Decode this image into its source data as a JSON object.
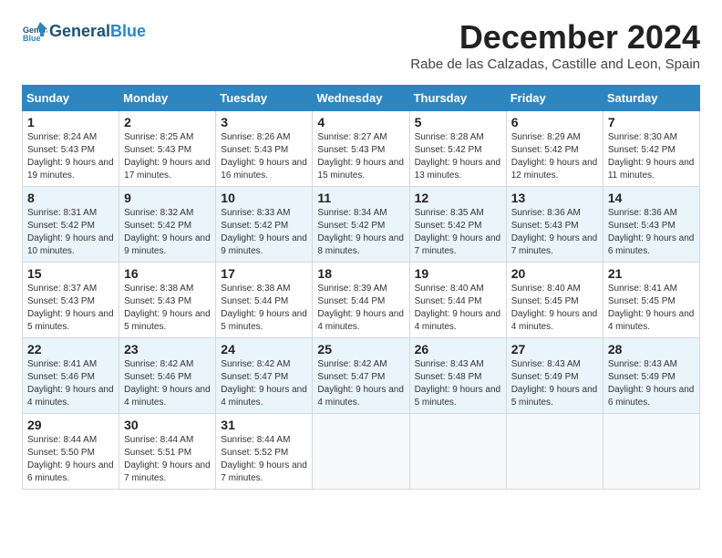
{
  "header": {
    "logo_general": "General",
    "logo_blue": "Blue",
    "month_title": "December 2024",
    "location": "Rabe de las Calzadas, Castille and Leon, Spain"
  },
  "weekdays": [
    "Sunday",
    "Monday",
    "Tuesday",
    "Wednesday",
    "Thursday",
    "Friday",
    "Saturday"
  ],
  "weeks": [
    [
      {
        "day": "1",
        "sunrise": "Sunrise: 8:24 AM",
        "sunset": "Sunset: 5:43 PM",
        "daylight": "Daylight: 9 hours and 19 minutes."
      },
      {
        "day": "2",
        "sunrise": "Sunrise: 8:25 AM",
        "sunset": "Sunset: 5:43 PM",
        "daylight": "Daylight: 9 hours and 17 minutes."
      },
      {
        "day": "3",
        "sunrise": "Sunrise: 8:26 AM",
        "sunset": "Sunset: 5:43 PM",
        "daylight": "Daylight: 9 hours and 16 minutes."
      },
      {
        "day": "4",
        "sunrise": "Sunrise: 8:27 AM",
        "sunset": "Sunset: 5:43 PM",
        "daylight": "Daylight: 9 hours and 15 minutes."
      },
      {
        "day": "5",
        "sunrise": "Sunrise: 8:28 AM",
        "sunset": "Sunset: 5:42 PM",
        "daylight": "Daylight: 9 hours and 13 minutes."
      },
      {
        "day": "6",
        "sunrise": "Sunrise: 8:29 AM",
        "sunset": "Sunset: 5:42 PM",
        "daylight": "Daylight: 9 hours and 12 minutes."
      },
      {
        "day": "7",
        "sunrise": "Sunrise: 8:30 AM",
        "sunset": "Sunset: 5:42 PM",
        "daylight": "Daylight: 9 hours and 11 minutes."
      }
    ],
    [
      {
        "day": "8",
        "sunrise": "Sunrise: 8:31 AM",
        "sunset": "Sunset: 5:42 PM",
        "daylight": "Daylight: 9 hours and 10 minutes."
      },
      {
        "day": "9",
        "sunrise": "Sunrise: 8:32 AM",
        "sunset": "Sunset: 5:42 PM",
        "daylight": "Daylight: 9 hours and 9 minutes."
      },
      {
        "day": "10",
        "sunrise": "Sunrise: 8:33 AM",
        "sunset": "Sunset: 5:42 PM",
        "daylight": "Daylight: 9 hours and 9 minutes."
      },
      {
        "day": "11",
        "sunrise": "Sunrise: 8:34 AM",
        "sunset": "Sunset: 5:42 PM",
        "daylight": "Daylight: 9 hours and 8 minutes."
      },
      {
        "day": "12",
        "sunrise": "Sunrise: 8:35 AM",
        "sunset": "Sunset: 5:42 PM",
        "daylight": "Daylight: 9 hours and 7 minutes."
      },
      {
        "day": "13",
        "sunrise": "Sunrise: 8:36 AM",
        "sunset": "Sunset: 5:43 PM",
        "daylight": "Daylight: 9 hours and 7 minutes."
      },
      {
        "day": "14",
        "sunrise": "Sunrise: 8:36 AM",
        "sunset": "Sunset: 5:43 PM",
        "daylight": "Daylight: 9 hours and 6 minutes."
      }
    ],
    [
      {
        "day": "15",
        "sunrise": "Sunrise: 8:37 AM",
        "sunset": "Sunset: 5:43 PM",
        "daylight": "Daylight: 9 hours and 5 minutes."
      },
      {
        "day": "16",
        "sunrise": "Sunrise: 8:38 AM",
        "sunset": "Sunset: 5:43 PM",
        "daylight": "Daylight: 9 hours and 5 minutes."
      },
      {
        "day": "17",
        "sunrise": "Sunrise: 8:38 AM",
        "sunset": "Sunset: 5:44 PM",
        "daylight": "Daylight: 9 hours and 5 minutes."
      },
      {
        "day": "18",
        "sunrise": "Sunrise: 8:39 AM",
        "sunset": "Sunset: 5:44 PM",
        "daylight": "Daylight: 9 hours and 4 minutes."
      },
      {
        "day": "19",
        "sunrise": "Sunrise: 8:40 AM",
        "sunset": "Sunset: 5:44 PM",
        "daylight": "Daylight: 9 hours and 4 minutes."
      },
      {
        "day": "20",
        "sunrise": "Sunrise: 8:40 AM",
        "sunset": "Sunset: 5:45 PM",
        "daylight": "Daylight: 9 hours and 4 minutes."
      },
      {
        "day": "21",
        "sunrise": "Sunrise: 8:41 AM",
        "sunset": "Sunset: 5:45 PM",
        "daylight": "Daylight: 9 hours and 4 minutes."
      }
    ],
    [
      {
        "day": "22",
        "sunrise": "Sunrise: 8:41 AM",
        "sunset": "Sunset: 5:46 PM",
        "daylight": "Daylight: 9 hours and 4 minutes."
      },
      {
        "day": "23",
        "sunrise": "Sunrise: 8:42 AM",
        "sunset": "Sunset: 5:46 PM",
        "daylight": "Daylight: 9 hours and 4 minutes."
      },
      {
        "day": "24",
        "sunrise": "Sunrise: 8:42 AM",
        "sunset": "Sunset: 5:47 PM",
        "daylight": "Daylight: 9 hours and 4 minutes."
      },
      {
        "day": "25",
        "sunrise": "Sunrise: 8:42 AM",
        "sunset": "Sunset: 5:47 PM",
        "daylight": "Daylight: 9 hours and 4 minutes."
      },
      {
        "day": "26",
        "sunrise": "Sunrise: 8:43 AM",
        "sunset": "Sunset: 5:48 PM",
        "daylight": "Daylight: 9 hours and 5 minutes."
      },
      {
        "day": "27",
        "sunrise": "Sunrise: 8:43 AM",
        "sunset": "Sunset: 5:49 PM",
        "daylight": "Daylight: 9 hours and 5 minutes."
      },
      {
        "day": "28",
        "sunrise": "Sunrise: 8:43 AM",
        "sunset": "Sunset: 5:49 PM",
        "daylight": "Daylight: 9 hours and 6 minutes."
      }
    ],
    [
      {
        "day": "29",
        "sunrise": "Sunrise: 8:44 AM",
        "sunset": "Sunset: 5:50 PM",
        "daylight": "Daylight: 9 hours and 6 minutes."
      },
      {
        "day": "30",
        "sunrise": "Sunrise: 8:44 AM",
        "sunset": "Sunset: 5:51 PM",
        "daylight": "Daylight: 9 hours and 7 minutes."
      },
      {
        "day": "31",
        "sunrise": "Sunrise: 8:44 AM",
        "sunset": "Sunset: 5:52 PM",
        "daylight": "Daylight: 9 hours and 7 minutes."
      },
      null,
      null,
      null,
      null
    ]
  ]
}
